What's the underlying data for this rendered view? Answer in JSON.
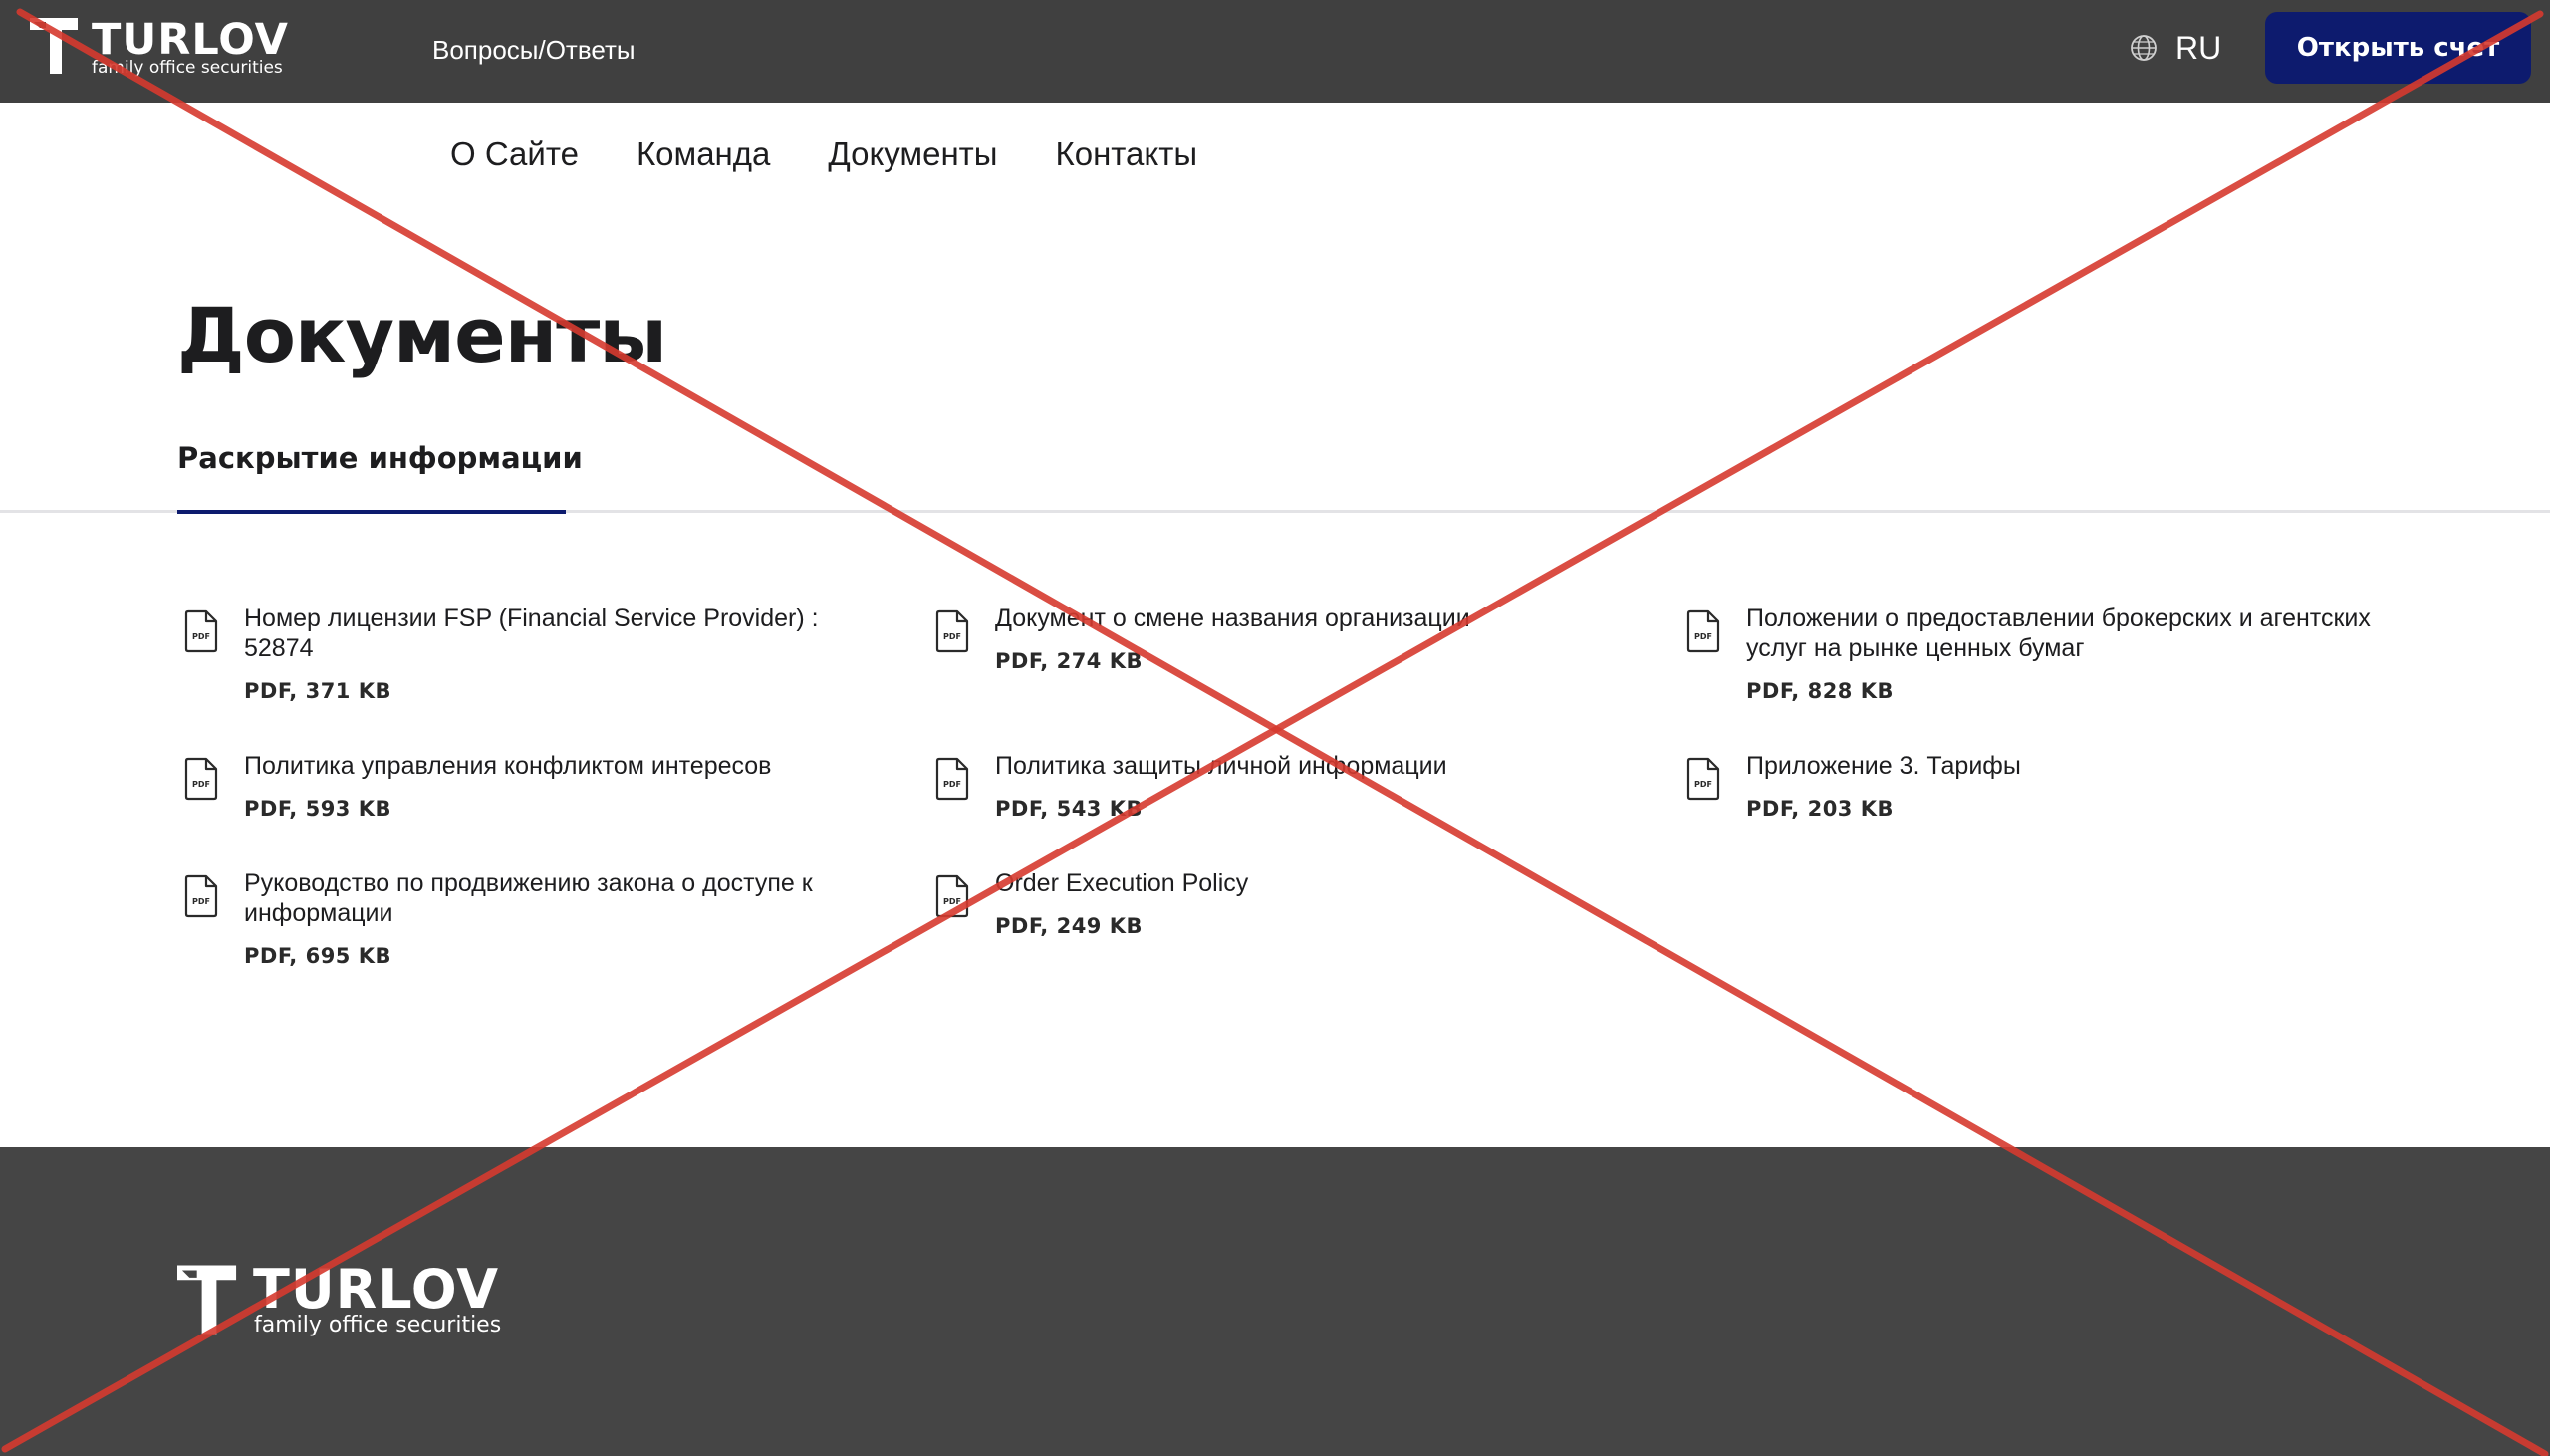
{
  "header": {
    "logo_word": "TURLOV",
    "logo_tagline": "family office securities",
    "faq_link": "Вопросы/Ответы",
    "language": "RU",
    "open_account_label": "Открыть счет"
  },
  "sub_nav": {
    "items": [
      "О Сайте",
      "Команда",
      "Документы",
      "Контакты"
    ]
  },
  "page": {
    "title": "Документы",
    "tabs": [
      {
        "label": "Раскрытие информации",
        "active": true
      }
    ]
  },
  "documents": [
    {
      "title": "Номер лицензии FSP (Financial Service Provider) : 52874",
      "meta": "PDF, 371 KB"
    },
    {
      "title": "Документ о смене названия организации",
      "meta": "PDF, 274 KB"
    },
    {
      "title": "Положении о предоставлении брокерских и агентских услуг на рынке ценных бумаг",
      "meta": "PDF, 828 KB"
    },
    {
      "title": "Политика управления конфликтом интересов",
      "meta": "PDF, 593 KB"
    },
    {
      "title": "Политика защиты личной информации",
      "meta": "PDF, 543 KB"
    },
    {
      "title": "Приложение 3. Тарифы",
      "meta": "PDF, 203 KB"
    },
    {
      "title": "Руководство по продвижению закона о доступе к информации",
      "meta": "PDF, 695 KB"
    },
    {
      "title": "Order Execution Policy",
      "meta": "PDF, 249 KB"
    }
  ],
  "icons": {
    "file": "pdf-file-icon",
    "file_badge": "PDF",
    "globe": "globe-icon",
    "logo": "turlov-logo-icon"
  },
  "footer": {
    "logo_word": "TURLOV",
    "logo_tagline": "family office securities"
  },
  "colors": {
    "header_bg": "#404040",
    "footer_bg": "#454545",
    "accent": "#0d1b6e",
    "overlay_cross": "#d63a2f"
  }
}
